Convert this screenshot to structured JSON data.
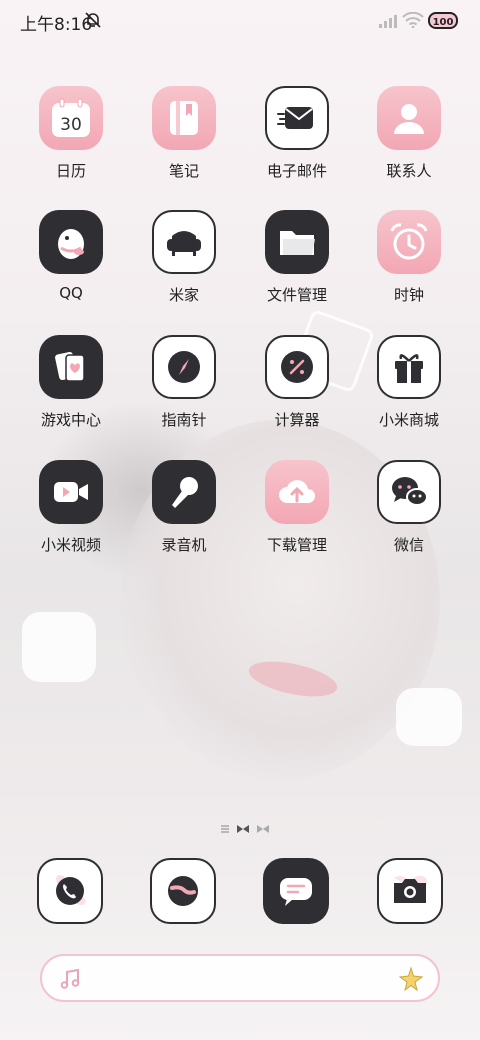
{
  "status": {
    "time": "上午8:16",
    "battery": "100"
  },
  "apps": [
    {
      "label": "日历",
      "day": "30",
      "icon": "calendar-icon"
    },
    {
      "label": "笔记",
      "icon": "notes-icon"
    },
    {
      "label": "电子邮件",
      "icon": "mail-icon"
    },
    {
      "label": "联系人",
      "icon": "contacts-icon"
    },
    {
      "label": "QQ",
      "icon": "qq-icon"
    },
    {
      "label": "米家",
      "icon": "sofa-icon"
    },
    {
      "label": "文件管理",
      "icon": "folder-icon"
    },
    {
      "label": "时钟",
      "icon": "alarm-clock-icon"
    },
    {
      "label": "游戏中心",
      "icon": "cards-icon"
    },
    {
      "label": "指南针",
      "icon": "compass-icon"
    },
    {
      "label": "计算器",
      "icon": "calculator-icon"
    },
    {
      "label": "小米商城",
      "icon": "gift-icon"
    },
    {
      "label": "小米视频",
      "icon": "video-icon"
    },
    {
      "label": "录音机",
      "icon": "microphone-icon"
    },
    {
      "label": "下载管理",
      "icon": "cloud-upload-icon"
    },
    {
      "label": "微信",
      "icon": "wechat-icon"
    }
  ],
  "dock": [
    {
      "icon": "phone-icon"
    },
    {
      "icon": "browser-icon"
    },
    {
      "icon": "message-icon"
    },
    {
      "icon": "camera-icon"
    }
  ]
}
